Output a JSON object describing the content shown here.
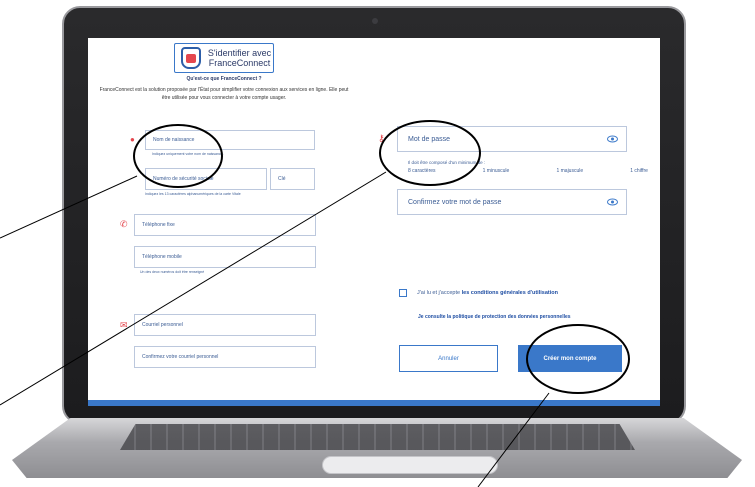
{
  "franceconnect": {
    "button_line1": "S'identifier avec",
    "button_line2": "FranceConnect",
    "question": "Qu'est-ce que FranceConnect ?",
    "description": "FranceConnect est la solution proposée par l'État pour simplifier votre connexion aux services en ligne. Elle peut être utilisée pour vous connecter à votre compte usager."
  },
  "identity": {
    "nom_placeholder": "Nom de naissance",
    "nom_hint": "Indiquez uniquement votre nom de naissance.",
    "nss_placeholder": "Numéro de sécurité sociale",
    "cle_placeholder": "Clé",
    "nss_hint": "Indiquez les 13 caractères alphanumériques de la carte Vitale"
  },
  "phone": {
    "fixe_placeholder": "Téléphone fixe",
    "mobile_placeholder": "Téléphone mobile",
    "hint": "Un des deux numéros doit être renseigné"
  },
  "email": {
    "email_placeholder": "Courriel personnel",
    "confirm_placeholder": "Confirmez votre courriel personnel"
  },
  "password": {
    "placeholder": "Mot de passe",
    "rule_intro": "Il doit être composé d'un minimum de :",
    "rules": [
      "8 caractères",
      "1 minuscule",
      "1 majuscule",
      "1 chiffre"
    ],
    "confirm_placeholder": "Confirmez votre mot de passe"
  },
  "terms": {
    "prefix": "J'ai lu et j'accepte",
    "link": "les conditions générales d'utilisation",
    "policy": "Je consulte la politique de protection des données personnelles"
  },
  "actions": {
    "cancel": "Annuler",
    "create": "Créer mon compte"
  },
  "icons": [
    "user-icon",
    "phone-icon",
    "mail-icon",
    "key-icon",
    "eye-icon"
  ],
  "colors": {
    "accent": "#3a78c9",
    "icon_red": "#e4474e",
    "text_blue": "#3b5c94"
  }
}
